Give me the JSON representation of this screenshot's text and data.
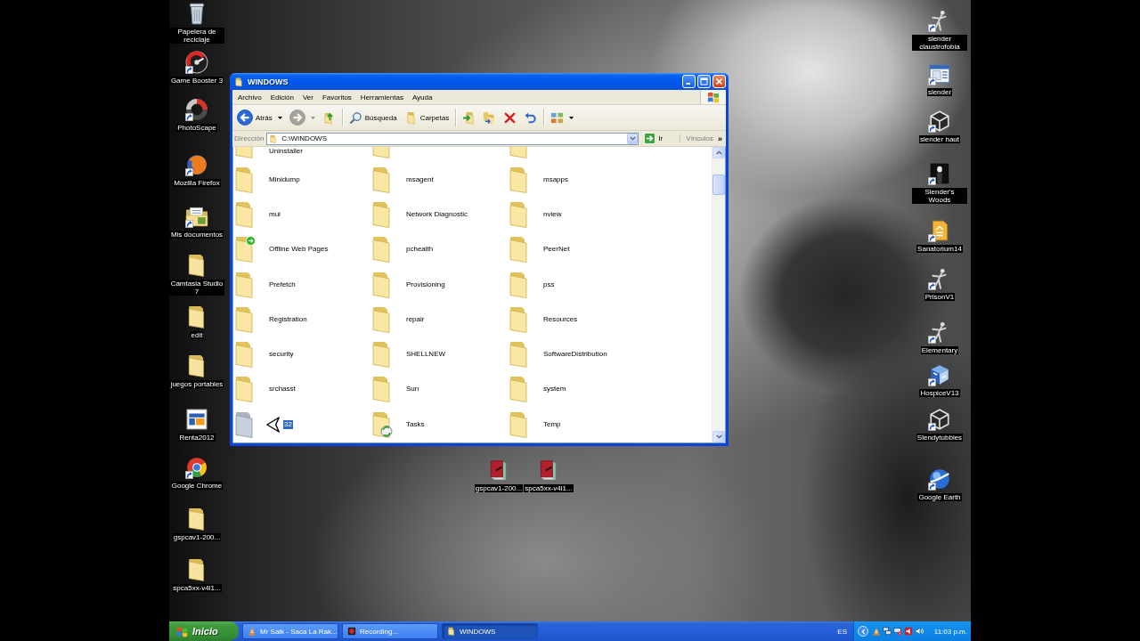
{
  "desktop": {
    "left_icons": [
      {
        "label": "Papelera de reciclaje",
        "kind": "bin",
        "shortcut": false
      },
      {
        "label": "Game Booster 3",
        "kind": "dial",
        "shortcut": true
      },
      {
        "label": "PhotoScape",
        "kind": "ring",
        "shortcut": true
      },
      {
        "label": "Mozilla Firefox",
        "kind": "orb",
        "shortcut": true
      },
      {
        "label": "Mis documentos",
        "kind": "docs",
        "shortcut": true
      },
      {
        "label": "Camtasia Studio 7",
        "kind": "folder",
        "shortcut": false
      },
      {
        "label": "edit",
        "kind": "folder",
        "shortcut": false
      },
      {
        "label": "juegos portables",
        "kind": "folder",
        "shortcut": false
      },
      {
        "label": "Renta2012",
        "kind": "tile",
        "shortcut": false
      },
      {
        "label": "Google Chrome",
        "kind": "wheel",
        "shortcut": true
      },
      {
        "label": "gspcav1-200...",
        "kind": "folder",
        "shortcut": false
      },
      {
        "label": "spca5xx-v4l1...",
        "kind": "folder",
        "shortcut": false
      }
    ],
    "right_icons": [
      {
        "label": "slender claustrofobia",
        "kind": "figure",
        "shortcut": true
      },
      {
        "label": "slender",
        "kind": "window",
        "shortcut": true
      },
      {
        "label": "slender haut",
        "kind": "cube",
        "shortcut": true
      },
      {
        "label": "Slender's Woods",
        "kind": "portrait",
        "shortcut": true
      },
      {
        "label": "Sanatorium14",
        "kind": "stack",
        "shortcut": true
      },
      {
        "label": "PrisonV1",
        "kind": "figure",
        "shortcut": true
      },
      {
        "label": "Elementary",
        "kind": "figure",
        "shortcut": true
      },
      {
        "label": "HospiceV13",
        "kind": "puzzle",
        "shortcut": true
      },
      {
        "label": "Slendytubbies",
        "kind": "cube",
        "shortcut": true
      },
      {
        "label": "Google Earth",
        "kind": "planet",
        "shortcut": true
      }
    ],
    "center_icons": [
      {
        "label": "gspcav1-200...",
        "kind": "book",
        "shortcut": false
      },
      {
        "label": "spca5xx-v4l1...",
        "kind": "book",
        "shortcut": false
      }
    ]
  },
  "window": {
    "title": "WINDOWS",
    "menu": [
      "Archivo",
      "Edición",
      "Ver",
      "Favoritos",
      "Herramientas",
      "Ayuda"
    ],
    "toolbar": [
      {
        "buttons": [
          {
            "kind": "back",
            "label": "Atrás",
            "disabled": false,
            "menu": true
          },
          {
            "kind": "forward",
            "disabled": true,
            "menu": true
          },
          {
            "kind": "up",
            "disabled": false,
            "menu": false
          }
        ]
      },
      {
        "buttons": [
          {
            "kind": "search",
            "label": "Búsqueda",
            "disabled": false,
            "menu": false
          },
          {
            "kind": "folders",
            "label": "Carpetas",
            "disabled": false,
            "menu": false
          }
        ]
      },
      {
        "buttons": [
          {
            "kind": "move",
            "disabled": false,
            "menu": false
          },
          {
            "kind": "copy",
            "disabled": false,
            "menu": false
          },
          {
            "kind": "delete",
            "disabled": false,
            "menu": false
          },
          {
            "kind": "undo",
            "disabled": false,
            "menu": false
          }
        ]
      },
      {
        "buttons": [
          {
            "kind": "views",
            "disabled": false,
            "menu": true
          }
        ]
      }
    ],
    "address": {
      "label": "Dirección",
      "value": "C:\\WINDOWS",
      "go": "Ir",
      "links": "Vínculos",
      "more": "»"
    },
    "items": [
      {
        "name": "Uninstaller",
        "kind": "folder",
        "selected": false
      },
      {
        "kind": "folder",
        "selected": false
      },
      {
        "kind": "folder",
        "selected": false
      },
      {
        "name": "Minidump",
        "kind": "folder",
        "selected": false
      },
      {
        "name": "msagent",
        "kind": "folder",
        "selected": false
      },
      {
        "name": "msapps",
        "kind": "folder",
        "selected": false
      },
      {
        "name": "mui",
        "kind": "folder",
        "selected": false
      },
      {
        "name": "Network Diagnostic",
        "kind": "folder",
        "selected": false
      },
      {
        "name": "nview",
        "kind": "folder",
        "selected": false
      },
      {
        "name": "Offline Web Pages",
        "kind": "offline",
        "selected": false
      },
      {
        "name": "pchealth",
        "kind": "folder",
        "selected": false
      },
      {
        "name": "PeerNet",
        "kind": "folder",
        "selected": false
      },
      {
        "name": "Prefetch",
        "kind": "folder",
        "selected": false
      },
      {
        "name": "Provisioning",
        "kind": "folder",
        "selected": false
      },
      {
        "name": "pss",
        "kind": "folder",
        "selected": false
      },
      {
        "name": "Registration",
        "kind": "folder",
        "selected": false
      },
      {
        "name": "repair",
        "kind": "folder",
        "selected": false
      },
      {
        "name": "Resources",
        "kind": "folder",
        "selected": false
      },
      {
        "name": "security",
        "kind": "folder",
        "selected": false
      },
      {
        "name": "SHELLNEW",
        "kind": "folder",
        "selected": false
      },
      {
        "name": "SoftwareDistribution",
        "kind": "folder",
        "selected": false
      },
      {
        "name": "srchasst",
        "kind": "folder",
        "selected": false
      },
      {
        "name": "Sun",
        "kind": "folder",
        "selected": false
      },
      {
        "name": "system",
        "kind": "folder",
        "selected": false
      },
      {
        "name": "32",
        "kind": "folder",
        "selected": true
      },
      {
        "name": "Tasks",
        "kind": "tasks",
        "selected": false
      },
      {
        "name": "Temp",
        "kind": "folder",
        "selected": false
      }
    ]
  },
  "taskbar": {
    "start": "Inicio",
    "tasks": [
      {
        "label": "Mr Saik - Saca La Rak...",
        "kind": "cone",
        "selected": false
      },
      {
        "label": "Recording...",
        "kind": "record",
        "selected": false
      },
      {
        "label": "WINDOWS",
        "kind": "folder",
        "selected": true
      }
    ],
    "language": "ES",
    "clock": "11:03 p.m."
  }
}
